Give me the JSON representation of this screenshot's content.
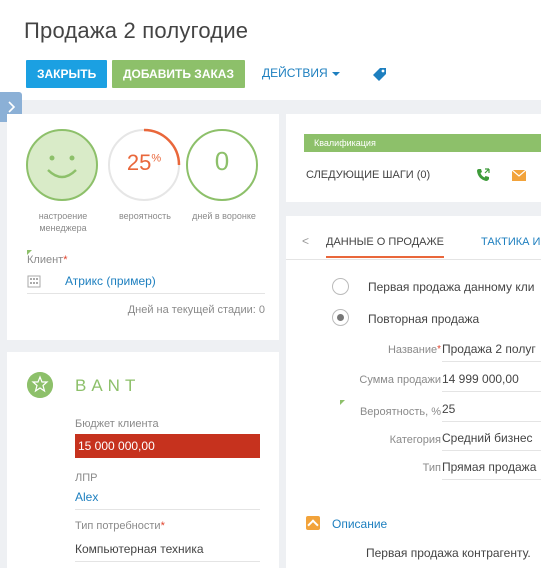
{
  "header": {
    "title": "Продажа 2 полугодие",
    "close_label": "ЗАКРЫТЬ",
    "add_order_label": "ДОБАВИТЬ ЗАКАЗ",
    "actions_label": "ДЕЙСТВИЯ"
  },
  "indicators": {
    "mood_label": "настроение менеджера",
    "probability_value": "25",
    "probability_unit": "%",
    "probability_label": "вероятность",
    "days_value": "0",
    "days_label": "дней в воронке"
  },
  "client": {
    "label": "Клиент",
    "required_mark": "*",
    "value": "Атрикс (пример)",
    "stage_days": "Дней на текущей стадии: 0"
  },
  "bant": {
    "title": "BANT",
    "budget_label": "Бюджет клиента",
    "budget_value": "15 000 000,00",
    "lpr_label": "ЛПР",
    "lpr_value": "Alex",
    "need_label": "Тип потребности",
    "need_required": "*",
    "need_value": "Компьютерная техника"
  },
  "qualification": {
    "stage_label": "Квалификация",
    "next_steps_label": "СЛЕДУЮЩИЕ ШАГИ (0)"
  },
  "details": {
    "tab_sale_data": "ДАННЫЕ О ПРОДАЖЕ",
    "tab_tactics": "ТАКТИКА И",
    "radio_first": "Первая продажа данному кли",
    "radio_repeat": "Повторная продажа",
    "name_label": "Название",
    "name_required": "*",
    "name_value": "Продажа 2 полуг",
    "sum_label": "Сумма продажи",
    "sum_value": "14 999 000,00",
    "prob_label": "Вероятность, %",
    "prob_value": "25",
    "category_label": "Категория",
    "category_value": "Средний бизнес",
    "type_label": "Тип",
    "type_value": "Прямая продажа",
    "description_title": "Описание",
    "description_text": "Первая продажа контрагенту."
  },
  "colors": {
    "blue": "#1ba0e2",
    "green": "#8dc06a",
    "orange": "#e9673b",
    "red": "#c6321e",
    "link": "#1d7fbf"
  }
}
